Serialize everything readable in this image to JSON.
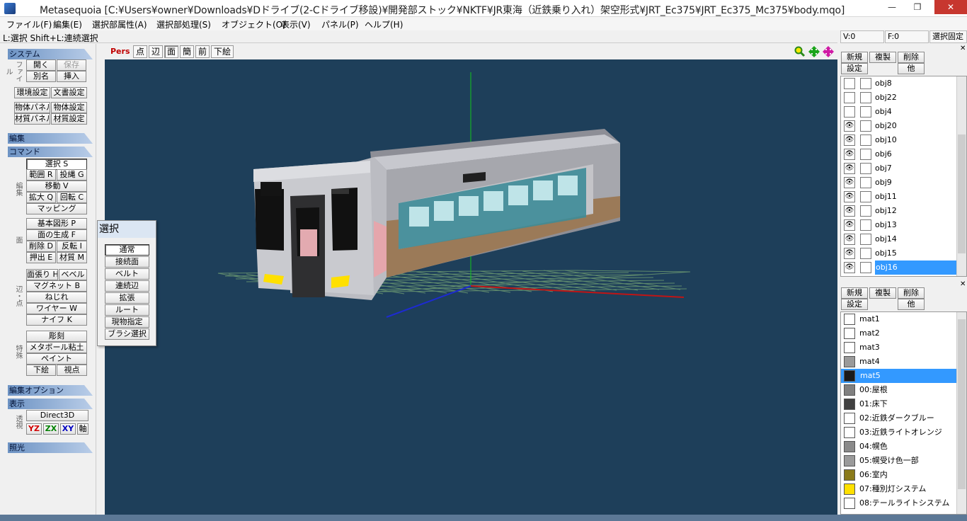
{
  "window": {
    "title": "Metasequoia [C:¥Users¥owner¥Downloads¥Dドライブ(2-Cドライブ移設)¥開発部ストック¥NKTF¥JR東海（近鉄乗り入れ）架空形式¥JRT_Ec375¥JRT_Ec375_Mc375¥body.mqo]",
    "minimize": "—",
    "maximize": "❐",
    "close": "✕"
  },
  "menu": [
    "ファイル(F)",
    "編集(E)",
    "選択部属性(A)",
    "選択部処理(S)",
    "オブジェクト(O)",
    "表示(V)",
    "パネル(P)",
    "ヘルプ(H)"
  ],
  "hint": "L:選択  Shift+L:連続選択",
  "status": {
    "v": "V:0",
    "f": "F:0",
    "lock": "選択固定"
  },
  "left": {
    "system": {
      "header": "システム",
      "file_label": "ファイル",
      "open": "開く",
      "save": "保存",
      "alias": "別名",
      "insert": "挿入",
      "env": "環境設定",
      "doc": "文書設定",
      "obj_panel": "物体パネル",
      "obj_set": "物体設定",
      "mat_panel": "材質パネル",
      "mat_set": "材質設定"
    },
    "edit_header": "編集",
    "command": {
      "header": "コマンド",
      "edit_label": "編集",
      "select": "選択 S",
      "range": "範囲 R",
      "lasso": "投縄 G",
      "move": "移動 V",
      "scale": "拡大 Q",
      "rotate": "回転 C",
      "mapping": "マッピング",
      "face_label": "面",
      "basic": "基本図形 P",
      "gen_face": "面の生成 F",
      "delete": "削除 D",
      "flip": "反転 I",
      "extrude": "押出 E",
      "material": "材質 M",
      "edge_label": "辺・点",
      "knife_face": "面張り H",
      "bevel": "ベベル",
      "magnet": "マグネット B",
      "twist": "ねじれ",
      "wire": "ワイヤー W",
      "knife": "ナイフ K",
      "special_label": "特殊",
      "sculpt": "彫刻",
      "metaball": "メタボール粘土",
      "paint": "ペイント",
      "underlay": "下絵",
      "viewpoint": "視点"
    },
    "edit_option_header": "編集オプション",
    "display": {
      "header": "表示",
      "persp_label": "透視",
      "direct3d": "Direct3D",
      "yz": "YZ",
      "zx": "ZX",
      "xy": "XY",
      "axis": "軸"
    },
    "light_header": "照光"
  },
  "popup": {
    "title": "選択",
    "items": [
      "通常",
      "接続面",
      "ベルト",
      "連続辺",
      "拡張",
      "ルート",
      "現物指定",
      "ブラシ選択"
    ]
  },
  "viewport": {
    "mode": "Pers",
    "buttons": [
      "点",
      "辺",
      "面",
      "簡",
      "前",
      "下絵"
    ]
  },
  "objects": {
    "new": "新規",
    "copy": "複製",
    "delete": "削除",
    "settings": "設定",
    "other": "他",
    "items": [
      {
        "name": "obj8",
        "visible": false
      },
      {
        "name": "obj22",
        "visible": false
      },
      {
        "name": "obj4",
        "visible": false
      },
      {
        "name": "obj20",
        "visible": true
      },
      {
        "name": "obj10",
        "visible": true
      },
      {
        "name": "obj6",
        "visible": true
      },
      {
        "name": "obj7",
        "visible": true
      },
      {
        "name": "obj9",
        "visible": true
      },
      {
        "name": "obj11",
        "visible": true
      },
      {
        "name": "obj12",
        "visible": true
      },
      {
        "name": "obj13",
        "visible": true
      },
      {
        "name": "obj14",
        "visible": true
      },
      {
        "name": "obj15",
        "visible": true
      },
      {
        "name": "obj16",
        "visible": true
      }
    ],
    "selected": "obj16"
  },
  "materials": {
    "new": "新規",
    "copy": "複製",
    "delete": "削除",
    "settings": "設定",
    "other": "他",
    "items": [
      {
        "name": "mat1",
        "color": "#ffffff"
      },
      {
        "name": "mat2",
        "color": "#ffffff"
      },
      {
        "name": "mat3",
        "color": "#ffffff"
      },
      {
        "name": "mat4",
        "color": "#9a9a9a"
      },
      {
        "name": "mat5",
        "color": "#1a1a1a"
      },
      {
        "name": "00:屋根",
        "color": "#808080"
      },
      {
        "name": "01:床下",
        "color": "#404040"
      },
      {
        "name": "02:近鉄ダークブルー",
        "color": "#ffffff"
      },
      {
        "name": "03:近鉄ライトオレンジ",
        "color": "#ffffff"
      },
      {
        "name": "04:幌色",
        "color": "#8a8a8a"
      },
      {
        "name": "05:幌受け色一部",
        "color": "#9a9a9a"
      },
      {
        "name": "06:室内",
        "color": "#8a7a1a"
      },
      {
        "name": "07:種別灯システム",
        "color": "#ffe000"
      },
      {
        "name": "08:テールライトシステム",
        "color": "#ffffff"
      }
    ],
    "selected": "mat5"
  },
  "icons": {
    "zoom": "magnifier-icon",
    "pan": "move-arrows-icon",
    "rotate": "rotate-arrows-icon"
  }
}
